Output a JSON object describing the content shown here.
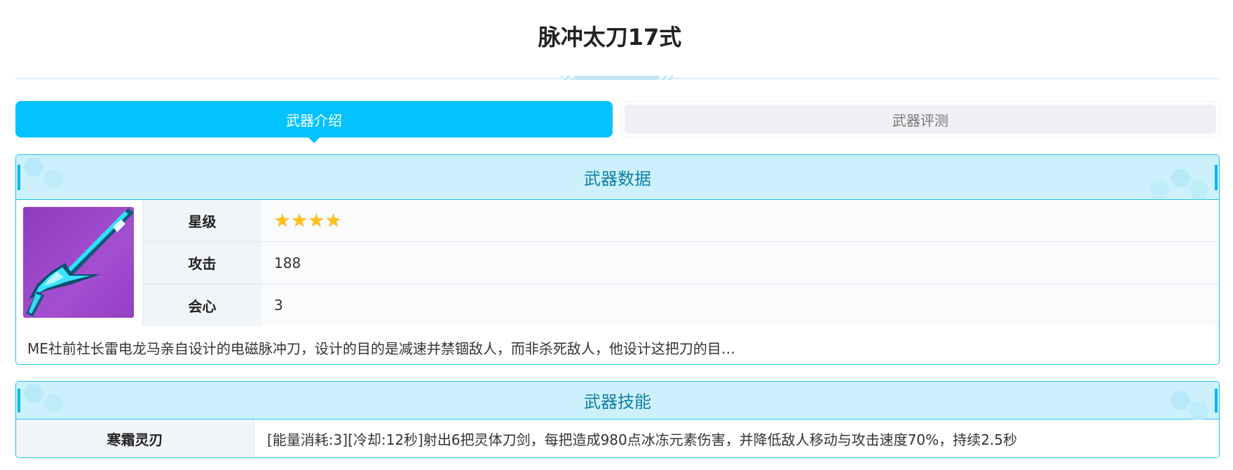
{
  "title": "脉冲太刀17式",
  "tabs": [
    {
      "label": "武器介绍",
      "active": true
    },
    {
      "label": "武器评测",
      "active": false
    }
  ],
  "weapon_data": {
    "header": "武器数据",
    "image_icon": "purple-energy-blade",
    "rows": [
      {
        "label": "星级",
        "stars": 4
      },
      {
        "label": "攻击",
        "value": "188"
      },
      {
        "label": "会心",
        "value": "3"
      }
    ],
    "description": "ME社前社长雷电龙马亲自设计的电磁脉冲刀，设计的目的是减速并禁锢敌人，而非杀死敌人，他设计这把刀的目…"
  },
  "weapon_skill": {
    "header": "武器技能",
    "name": "寒霜灵刃",
    "description": "[能量消耗:3][冷却:12秒]射出6把灵体刀剑，每把造成980点冰冻元素伤害，并降低敌人移动与攻击速度70%，持续2.5秒"
  },
  "colors": {
    "accent": "#03c3ff",
    "header_bg": "#ccf1fc",
    "header_text": "#0f7fa6",
    "border": "#20c4ef",
    "star": "#ffc21a"
  }
}
